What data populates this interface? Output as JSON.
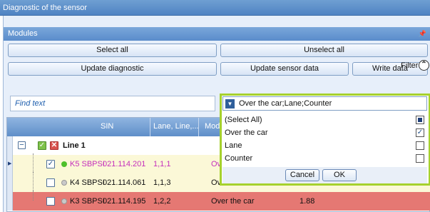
{
  "window": {
    "title": "Diagnostic of the sensor"
  },
  "modules": {
    "title": "Modules",
    "pin_icon": "pin-icon"
  },
  "toolbar": {
    "select_all": "Select all",
    "unselect_all": "Unselect all",
    "update_diagnostic": "Update diagnostic",
    "update_sensor_data": "Update sensor data",
    "write_data": "Write data"
  },
  "filter": {
    "label": "Filter",
    "toggle_icon": "chevron-up-icon"
  },
  "search": {
    "placeholder": "Find text"
  },
  "grid": {
    "columns": [
      "SIN",
      "Lane, Line,...",
      "Mod"
    ],
    "group": {
      "label": "Line 1"
    },
    "rows": [
      {
        "name": "K5 SBPSI",
        "sin": "021.114.201",
        "lane": "1,1,1",
        "mode": "Ov",
        "value": "",
        "checked": true,
        "status": "green",
        "highlight": "yellow"
      },
      {
        "name": "K4 SBPSI",
        "sin": "021.114.061",
        "lane": "1,1,3",
        "mode": "Ov",
        "value": "",
        "checked": false,
        "status": "grey",
        "highlight": "yellow"
      },
      {
        "name": "K3 SBPSI",
        "sin": "021.114.195",
        "lane": "1,2,2",
        "mode": "Over the car",
        "value": "1.88",
        "checked": false,
        "status": "grey",
        "highlight": "red"
      }
    ]
  },
  "mode_filter": {
    "value": "Over the car;Lane;Counter",
    "options": [
      {
        "label": "(Select All)",
        "state": "partial"
      },
      {
        "label": "Over the car",
        "state": "checked"
      },
      {
        "label": "Lane",
        "state": "unchecked"
      },
      {
        "label": "Counter",
        "state": "unchecked"
      }
    ],
    "cancel": "Cancel",
    "ok": "OK"
  },
  "colors": {
    "accent": "#5a8ccb",
    "popup_border": "#a6d12d",
    "row_yellow": "#fbf8d7",
    "row_red": "#e57873"
  }
}
